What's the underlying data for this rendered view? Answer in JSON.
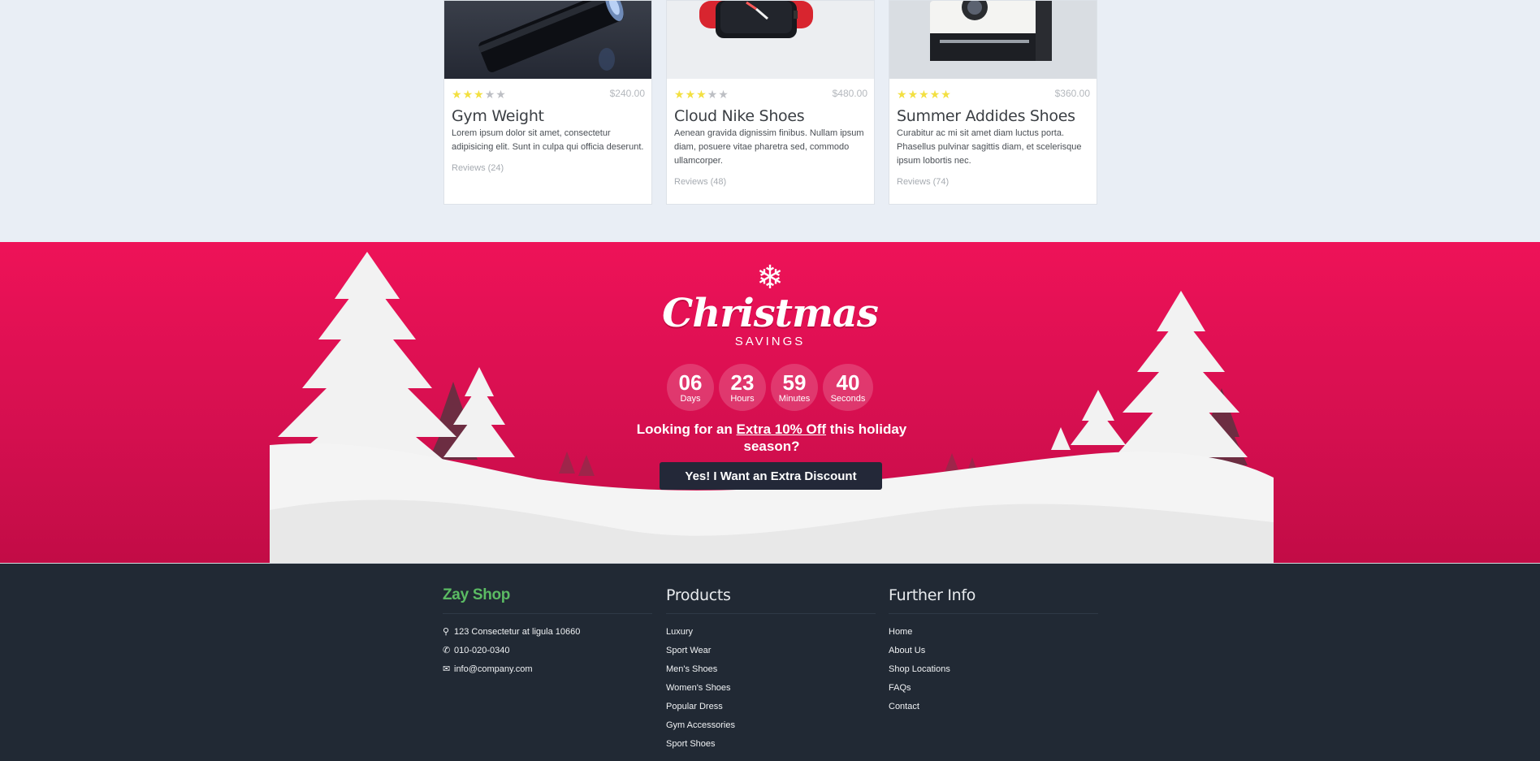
{
  "products": [
    {
      "title": "Gym Weight",
      "price": "$240.00",
      "rating": 3,
      "description": "Lorem ipsum dolor sit amet, consectetur adipisicing elit. Sunt in culpa qui officia deserunt.",
      "reviews": "Reviews (24)"
    },
    {
      "title": "Cloud Nike Shoes",
      "price": "$480.00",
      "rating": 3,
      "description": "Aenean gravida dignissim finibus. Nullam ipsum diam, posuere vitae pharetra sed, commodo ullamcorper.",
      "reviews": "Reviews (48)"
    },
    {
      "title": "Summer Addides Shoes",
      "price": "$360.00",
      "rating": 5,
      "description": "Curabitur ac mi sit amet diam luctus porta. Phasellus pulvinar sagittis diam, et scelerisque ipsum lobortis nec.",
      "reviews": "Reviews (74)"
    }
  ],
  "promo": {
    "logo_script": "Christmas",
    "logo_sub": "SAVINGS",
    "countdown": [
      {
        "value": "06",
        "label": "Days"
      },
      {
        "value": "23",
        "label": "Hours"
      },
      {
        "value": "59",
        "label": "Minutes"
      },
      {
        "value": "40",
        "label": "Seconds"
      }
    ],
    "offer_before": "Looking for an ",
    "offer_highlight": "Extra 10% Off",
    "offer_after": " this holiday season?",
    "cta_label": "Yes! I Want an Extra Discount"
  },
  "footer": {
    "brand": "Zay Shop",
    "contact": [
      {
        "icon": "map-marker-icon",
        "text": "123 Consectetur at ligula 10660"
      },
      {
        "icon": "phone-icon",
        "text": "010-020-0340"
      },
      {
        "icon": "envelope-icon",
        "text": "info@company.com"
      }
    ],
    "products_title": "Products",
    "products": [
      "Luxury",
      "Sport Wear",
      "Men's Shoes",
      "Women's Shoes",
      "Popular Dress",
      "Gym Accessories",
      "Sport Shoes"
    ],
    "info_title": "Further Info",
    "info": [
      "Home",
      "About Us",
      "Shop Locations",
      "FAQs",
      "Contact"
    ]
  },
  "colors": {
    "promo_bg": "#ee1258",
    "footer_bg": "#212934",
    "brand": "#5bbb63",
    "star": "#f3e041",
    "cta_bg": "#232838"
  }
}
